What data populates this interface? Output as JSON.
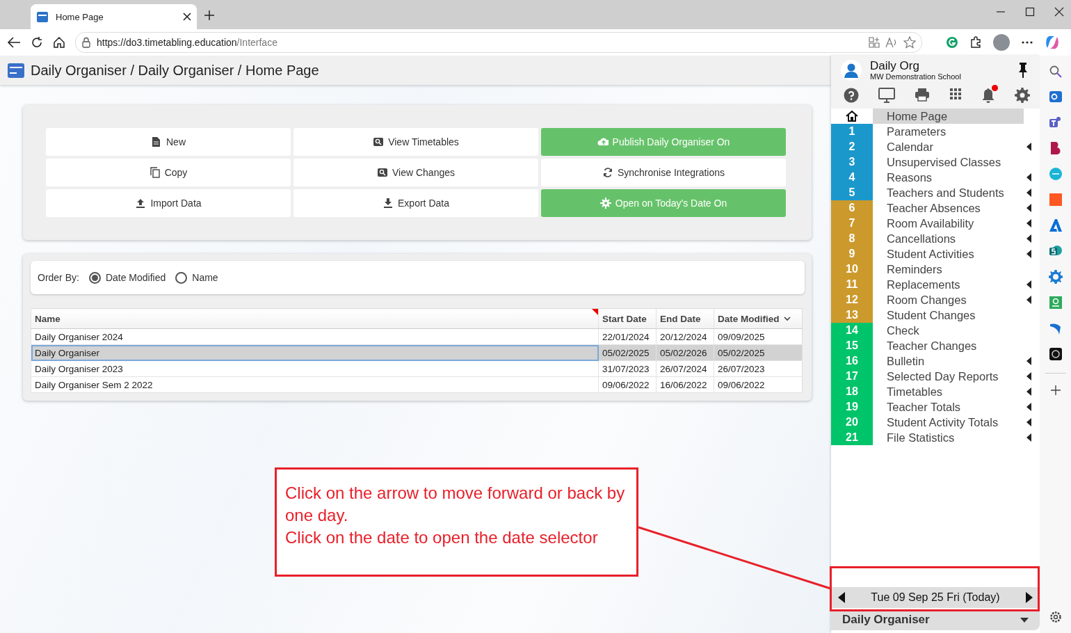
{
  "browser": {
    "tab_title": "Home Page",
    "url_host": "https://do3.timetabling.education",
    "url_path": "/Interface"
  },
  "page_title": "Daily Organiser / Daily Organiser / Home Page",
  "actions": [
    {
      "label": "New",
      "highlighted": false
    },
    {
      "label": "View Timetables",
      "highlighted": false
    },
    {
      "label": "Publish Daily Organiser On",
      "highlighted": true
    },
    {
      "label": "Copy",
      "highlighted": false
    },
    {
      "label": "View Changes",
      "highlighted": false
    },
    {
      "label": "Synchronise Integrations",
      "highlighted": false
    },
    {
      "label": "Import Data",
      "highlighted": false
    },
    {
      "label": "Export Data",
      "highlighted": false
    },
    {
      "label": "Open on Today's Date On",
      "highlighted": true
    }
  ],
  "order_by": {
    "label": "Order By:",
    "options": [
      {
        "label": "Date Modified",
        "selected": true
      },
      {
        "label": "Name",
        "selected": false
      }
    ]
  },
  "table": {
    "columns": [
      {
        "label": "Name",
        "sorted": false
      },
      {
        "label": "Start Date",
        "sorted": false
      },
      {
        "label": "End Date",
        "sorted": false
      },
      {
        "label": "Date Modified",
        "sorted": true
      }
    ],
    "rows": [
      {
        "cells": [
          "Daily Organiser 2024",
          "22/01/2024",
          "20/12/2024",
          "09/09/2025"
        ],
        "selected": false
      },
      {
        "cells": [
          "Daily Organiser",
          "05/02/2025",
          "05/02/2026",
          "05/02/2025"
        ],
        "selected": true
      },
      {
        "cells": [
          "Daily Organiser 2023",
          "31/07/2023",
          "26/07/2024",
          "26/07/2023"
        ],
        "selected": false
      },
      {
        "cells": [
          "Daily Organiser Sem 2 2022",
          "09/06/2022",
          "16/06/2022",
          "09/06/2022"
        ],
        "selected": false
      }
    ]
  },
  "panel": {
    "user": "Daily Org",
    "school": "MW Demonstration School",
    "notification": true,
    "menu": [
      {
        "kind": "home",
        "label": "Home Page",
        "submenu": false,
        "selected": true
      },
      {
        "kind": "numbered",
        "number": "1",
        "label": "Parameters",
        "color": "#1a98cc",
        "submenu": false,
        "selected": false
      },
      {
        "kind": "numbered",
        "number": "2",
        "label": "Calendar",
        "color": "#1a98cc",
        "submenu": true,
        "selected": false
      },
      {
        "kind": "numbered",
        "number": "3",
        "label": "Unsupervised Classes",
        "color": "#1a98cc",
        "submenu": false,
        "selected": false
      },
      {
        "kind": "numbered",
        "number": "4",
        "label": "Reasons",
        "color": "#1a98cc",
        "submenu": true,
        "selected": false
      },
      {
        "kind": "numbered",
        "number": "5",
        "label": "Teachers and Students",
        "color": "#1a98cc",
        "submenu": true,
        "selected": false
      },
      {
        "kind": "numbered",
        "number": "6",
        "label": "Teacher Absences",
        "color": "#cc9a2c",
        "submenu": true,
        "selected": false
      },
      {
        "kind": "numbered",
        "number": "7",
        "label": "Room Availability",
        "color": "#cc9a2c",
        "submenu": true,
        "selected": false
      },
      {
        "kind": "numbered",
        "number": "8",
        "label": "Cancellations",
        "color": "#cc9a2c",
        "submenu": true,
        "selected": false
      },
      {
        "kind": "numbered",
        "number": "9",
        "label": "Student Activities",
        "color": "#cc9a2c",
        "submenu": true,
        "selected": false
      },
      {
        "kind": "numbered",
        "number": "10",
        "label": "Reminders",
        "color": "#cc9a2c",
        "submenu": false,
        "selected": false
      },
      {
        "kind": "numbered",
        "number": "11",
        "label": "Replacements",
        "color": "#cc9a2c",
        "submenu": true,
        "selected": false
      },
      {
        "kind": "numbered",
        "number": "12",
        "label": "Room Changes",
        "color": "#cc9a2c",
        "submenu": true,
        "selected": false
      },
      {
        "kind": "numbered",
        "number": "13",
        "label": "Student Changes",
        "color": "#cc9a2c",
        "submenu": false,
        "selected": false
      },
      {
        "kind": "numbered",
        "number": "14",
        "label": "Check",
        "color": "#00c46a",
        "submenu": false,
        "selected": false
      },
      {
        "kind": "numbered",
        "number": "15",
        "label": "Teacher Changes",
        "color": "#00c46a",
        "submenu": false,
        "selected": false
      },
      {
        "kind": "numbered",
        "number": "16",
        "label": "Bulletin",
        "color": "#00c46a",
        "submenu": true,
        "selected": false
      },
      {
        "kind": "numbered",
        "number": "17",
        "label": "Selected Day Reports",
        "color": "#00c46a",
        "submenu": true,
        "selected": false
      },
      {
        "kind": "numbered",
        "number": "18",
        "label": "Timetables",
        "color": "#00c46a",
        "submenu": true,
        "selected": false
      },
      {
        "kind": "numbered",
        "number": "19",
        "label": "Teacher Totals",
        "color": "#00c46a",
        "submenu": true,
        "selected": false
      },
      {
        "kind": "numbered",
        "number": "20",
        "label": "Student Activity Totals",
        "color": "#00c46a",
        "submenu": true,
        "selected": false
      },
      {
        "kind": "numbered",
        "number": "21",
        "label": "File Statistics",
        "color": "#00c46a",
        "submenu": true,
        "selected": false
      }
    ],
    "date": "Tue 09 Sep 25 Fri (Today)",
    "organiser": "Daily Organiser"
  },
  "annotation": {
    "paragraphs": [
      "Click on the arrow to move forward or back by one day.",
      "Click on the date to open the date selector"
    ]
  }
}
